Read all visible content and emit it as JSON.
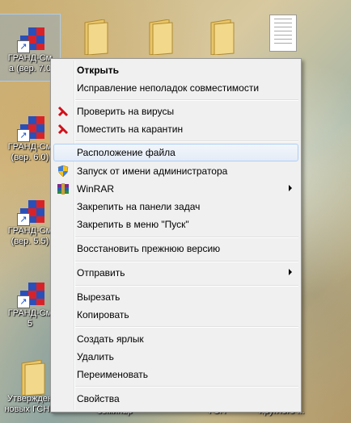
{
  "desktop": {
    "icons": [
      {
        "label": "ГРАНД-См",
        "label2": "а (вер. 7.0"
      },
      {
        "label": "ГРАНД-См",
        "label2": "(вер. 6.0)"
      },
      {
        "label": "ГРАНД-См",
        "label2": "(вер. 5.5)"
      },
      {
        "label": "ГРАНД-См",
        "label2": "5"
      },
      {
        "label": "Утвержден",
        "label2": "новых ГСНЬ"
      }
    ],
    "bottom_labels": [
      "семинар",
      "ГСН",
      "Круглого ..."
    ]
  },
  "context_menu": {
    "items": [
      {
        "label": "Открыть"
      },
      {
        "label": "Исправление неполадок совместимости"
      },
      {
        "label": "Проверить на вирусы"
      },
      {
        "label": "Поместить на карантин"
      },
      {
        "label": "Расположение файла"
      },
      {
        "label": "Запуск от имени администратора"
      },
      {
        "label": "WinRAR"
      },
      {
        "label": "Закрепить на панели задач"
      },
      {
        "label": "Закрепить в меню \"Пуск\""
      },
      {
        "label": "Восстановить прежнюю версию"
      },
      {
        "label": "Отправить"
      },
      {
        "label": "Вырезать"
      },
      {
        "label": "Копировать"
      },
      {
        "label": "Создать ярлык"
      },
      {
        "label": "Удалить"
      },
      {
        "label": "Переименовать"
      },
      {
        "label": "Свойства"
      }
    ]
  }
}
